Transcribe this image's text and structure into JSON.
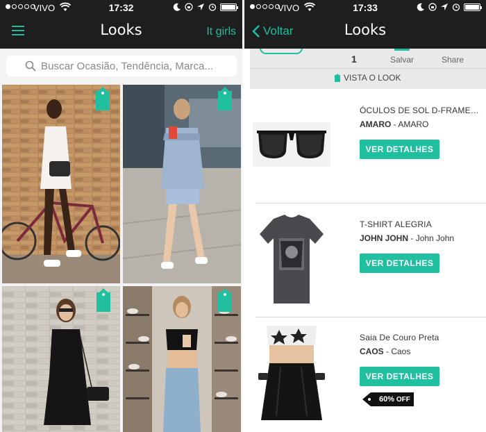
{
  "status_left": {
    "carrier": "VIVO",
    "time": "17:32"
  },
  "status_right": {
    "carrier": "VIVO",
    "time": "17:33"
  },
  "screen_looks": {
    "title": "Looks",
    "right_link": "It girls",
    "search_placeholder": "Buscar Ocasião, Tendência, Marca..."
  },
  "screen_detail": {
    "back_label": "Voltar",
    "title": "Looks",
    "likes_count": "1",
    "save_label": "Salvar",
    "share_label": "Share",
    "view_look_label": "VISTA O LOOK",
    "products": [
      {
        "name": "ÓCULOS DE SOL D-FRAMED...",
        "brand": "AMARO",
        "store": "AMARO",
        "button": "VER DETALHES"
      },
      {
        "name": "T-SHIRT ALEGRIA",
        "brand": "JOHN JOHN",
        "store": "John John",
        "button": "VER DETALHES"
      },
      {
        "name": "Saia De Couro Preta",
        "brand": "CAOS",
        "store": "Caos",
        "button": "VER DETALHES",
        "discount": "60%",
        "discount_suffix": "OFF"
      }
    ]
  },
  "colors": {
    "accent": "#1fbfa0",
    "topbar": "#1e1e1e"
  },
  "icons": [
    "hamburger-icon",
    "search-icon",
    "tag-icon",
    "back-chevron-icon",
    "wifi-icon",
    "battery-icon",
    "moon-icon",
    "location-icon",
    "alarm-icon",
    "lock-rotation-icon"
  ]
}
